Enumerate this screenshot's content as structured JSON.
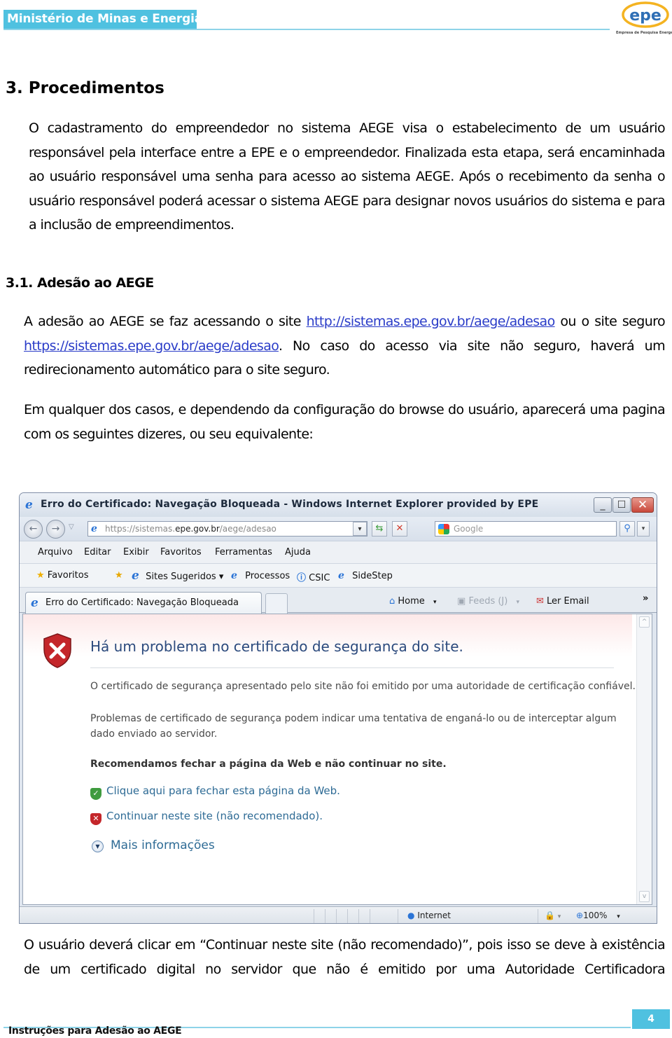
{
  "header": {
    "ministry": "Ministério de Minas e Energia",
    "logo_text": "epe",
    "logo_subtitle": "Empresa de Pesquisa Energética",
    "accent_color": "#4fc1e0",
    "logo_color": "#f0a500"
  },
  "section": {
    "heading": "3. Procedimentos",
    "paragraph": "O cadastramento do empreendedor no sistema AEGE visa o estabelecimento de um usuário responsável pela interface entre a EPE e o empreendedor. Finalizada esta etapa, será encaminhada ao usuário responsável uma senha para acesso ao sistema AEGE.  Após o recebimento da senha o usuário responsável poderá acessar o sistema AEGE para designar novos usuários do sistema e para a inclusão de empreendimentos."
  },
  "subsection": {
    "heading": "3.1.  Adesão ao AEGE",
    "p1_before": "A adesão ao AEGE se faz acessando o site ",
    "link_http": "http://sistemas.epe.gov.br/aege/adesao",
    "p1_middle": " ou o site seguro ",
    "link_https": "https://sistemas.epe.gov.br/aege/adesao",
    "p1_after": ".  No caso do acesso via site não seguro, haverá um redirecionamento automático para o site seguro.",
    "p2": "Em qualquer dos casos, e dependendo da configuração do browse do usuário, aparecerá uma pagina com os seguintes dizeres, ou seu equivalente:",
    "p3": "O usuário deverá clicar em “Continuar neste site (não recomendado)”, pois isso se deve à existência de um certificado digital no servidor que não é emitido por uma Autoridade Certificadora"
  },
  "browser": {
    "window_title": "Erro do Certificado: Navegação Bloqueada - Windows Internet Explorer provided by EPE",
    "minimize": "_",
    "maximize": "☐",
    "close": "✕",
    "address_prefix": "https://sistemas.",
    "address_domain": "epe.gov.br",
    "address_suffix": "/aege/adesao",
    "search_placeholder": "Google",
    "menu": [
      "Arquivo",
      "Editar",
      "Exibir",
      "Favoritos",
      "Ferramentas",
      "Ajuda"
    ],
    "favorites": {
      "favoritos": "Favoritos",
      "sites_sugeridos": "Sites Sugeridos ▾",
      "processos": "Processos",
      "csic": "CSIC",
      "sidestep": "SideStep"
    },
    "tab_title": "Erro do Certificado: Navegação Bloqueada",
    "commands": {
      "home": "Home",
      "feeds": "Feeds (J)",
      "read_mail": "Ler Email",
      "more": "»"
    },
    "page": {
      "title": "Há um problema no certificado de segurança do site.",
      "line1": "O certificado de segurança apresentado pelo site não foi emitido por uma autoridade de certificação confiável.",
      "line2a": "Problemas de certificado de segurança podem indicar uma tentativa de enganá-lo ou de interceptar algum",
      "line2b": "dado enviado ao servidor.",
      "recommend": "Recomendamos fechar a página da Web e não continuar no site.",
      "option_close": "Clique aqui para fechar esta página da Web.",
      "option_continue": "Continuar neste site (não recomendado).",
      "more_info": "Mais informações"
    },
    "status": {
      "zone": "Internet",
      "zoom": "100%"
    }
  },
  "footer": {
    "doc_title": "Instruções para Adesão ao AEGE",
    "page_number": "4"
  }
}
